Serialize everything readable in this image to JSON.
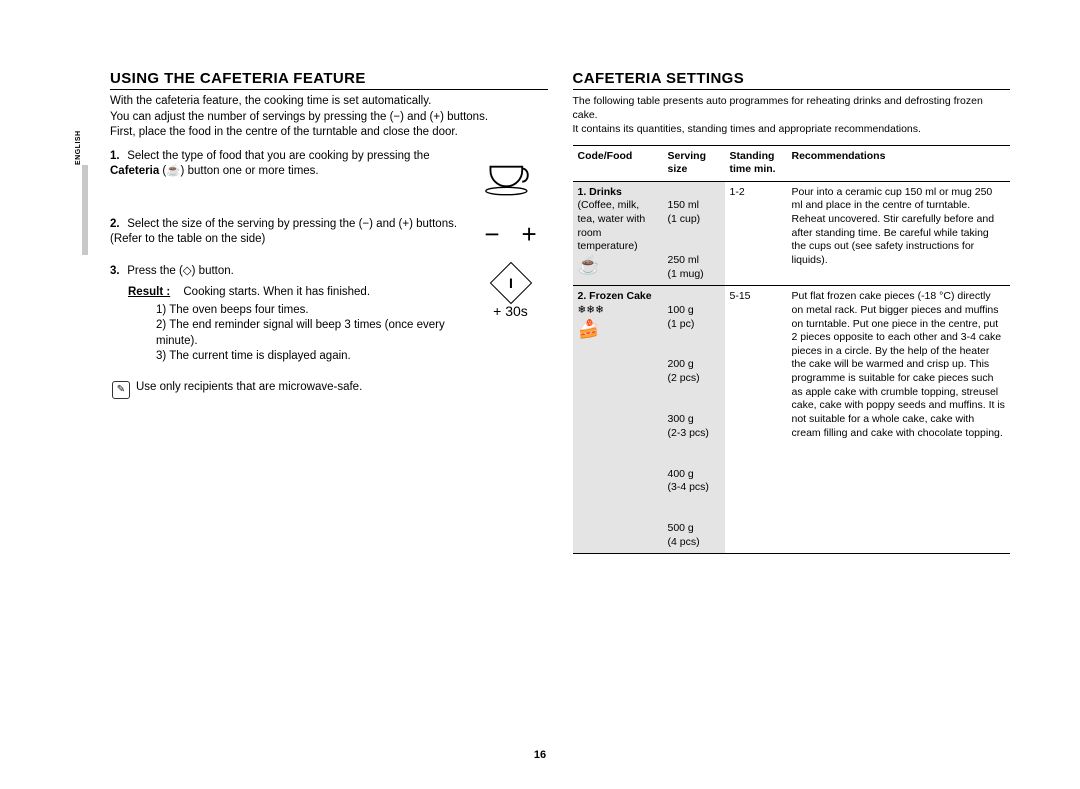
{
  "language_tab": "ENGLISH",
  "page_number": "16",
  "left": {
    "heading": "USING THE CAFETERIA FEATURE",
    "intro1": "With the cafeteria feature, the cooking time is set automatically.",
    "intro2": "You can adjust the number of servings by pressing the (−) and (+) buttons.",
    "intro3": "First, place the food in the centre of the turntable and close the door.",
    "step1_num": "1.",
    "step1a": "Select the type of food that you are cooking by pressing the ",
    "step1bold": "Cafeteria",
    "step1b": " (☕) button one or more times.",
    "step2_num": "2.",
    "step2": "Select the size of the serving by pressing the (−) and (+) buttons. (Refer to the table on the side)",
    "step3_num": "3.",
    "step3": "Press the (◇) button.",
    "result_label": "Result :",
    "result_lead": "Cooking starts. When it has finished.",
    "result_items": [
      "1)  The oven beeps four times.",
      "2)  The end reminder signal will beep 3 times (once every minute).",
      "3)  The current time is displayed again."
    ],
    "note": "Use only recipients that are microwave-safe.",
    "plus30": "+ 30s"
  },
  "right": {
    "heading": "CAFETERIA SETTINGS",
    "intro1": "The following table presents auto programmes for reheating drinks and defrosting frozen cake.",
    "intro2": "It contains its quantities, standing times and appropriate recommendations.",
    "table": {
      "headers": {
        "code": "Code/Food",
        "serving": "Serving size",
        "standing": "Standing time min.",
        "rec": "Recommendations"
      },
      "rows": [
        {
          "code_title": "1. Drinks",
          "code_desc": "(Coffee, milk, tea, water with room temperature)",
          "icon": "coffee-icon",
          "servings": [
            "150 ml\n(1 cup)",
            "250 ml\n(1 mug)"
          ],
          "standing": "1-2",
          "rec": "Pour into a ceramic cup 150 ml or mug 250 ml and place in the centre of turntable. Reheat uncovered. Stir carefully before and after standing time. Be careful while taking the cups out (see safety instructions for liquids)."
        },
        {
          "code_title": "2. Frozen Cake",
          "code_desc": "❄❄❄",
          "icon": "cake-icon",
          "servings": [
            "100 g\n(1 pc)",
            "200 g\n(2 pcs)",
            "300 g\n(2-3 pcs)",
            "400 g\n(3-4 pcs)",
            "500 g\n(4 pcs)"
          ],
          "standing": "5-15",
          "rec": "Put flat frozen cake pieces (-18 °C) directly on metal rack. Put bigger pieces and muffins on turntable. Put one piece in the centre, put 2 pieces opposite to each other and 3-4 cake pieces in a circle. By the help of the heater the cake will be warmed and crisp up. This programme is suitable for cake pieces such as apple cake with crumble topping, streusel cake, cake with poppy seeds and muffins. It is not suitable for a whole cake, cake with cream filling and cake with chocolate topping."
        }
      ]
    }
  }
}
